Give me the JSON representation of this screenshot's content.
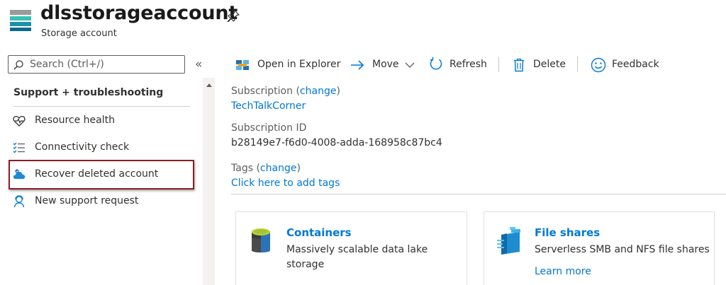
{
  "header": {
    "title": "dlsstorageaccount",
    "subtitle": "Storage account",
    "icons": {
      "resource": "storage-account-icon",
      "pin": "pin-icon"
    }
  },
  "sidebar": {
    "search_placeholder": "Search (Ctrl+/)",
    "collapse_label": "«",
    "section_title": "Support + troubleshooting",
    "items": [
      {
        "label": "Resource health",
        "icon": "heart-pulse-icon"
      },
      {
        "label": "Connectivity check",
        "icon": "checklist-icon"
      },
      {
        "label": "Recover deleted account",
        "icon": "cloud-restore-icon",
        "highlighted": true
      },
      {
        "label": "New support request",
        "icon": "support-person-icon"
      }
    ]
  },
  "toolbar": {
    "open_explorer": "Open in Explorer",
    "move": "Move",
    "refresh": "Refresh",
    "delete": "Delete",
    "feedback": "Feedback"
  },
  "essentials": {
    "subscription_label": "Subscription",
    "subscription_change": "change",
    "subscription_value": "TechTalkCorner",
    "subscription_id_label": "Subscription ID",
    "subscription_id_value": "b28149e7-f6d0-4008-adda-168958c87bc4",
    "tags_label": "Tags",
    "tags_change": "change",
    "tags_add": "Click here to add tags"
  },
  "cards": [
    {
      "title": "Containers",
      "desc": "Massively scalable data lake storage",
      "icon": "containers-icon"
    },
    {
      "title": "File shares",
      "desc": "Serverless SMB and NFS file shares",
      "link": "Learn more",
      "icon": "file-shares-icon"
    }
  ],
  "colors": {
    "link": "#0078d4",
    "highlight_border": "#8b1e24",
    "text": "#323130"
  }
}
